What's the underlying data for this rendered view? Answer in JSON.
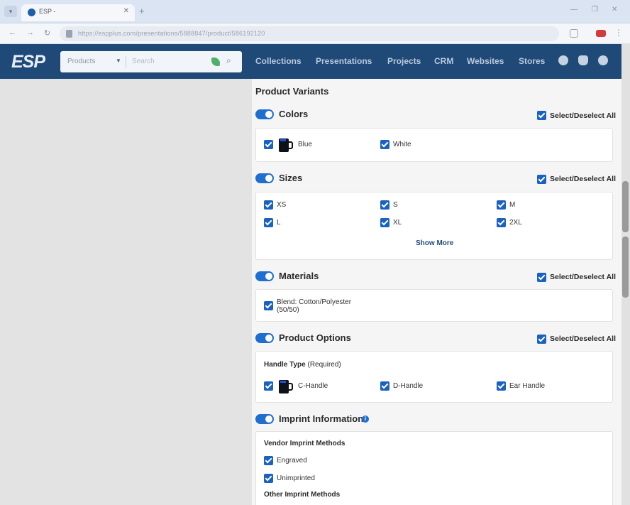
{
  "browser": {
    "tab_title": "ESP -",
    "url": "https://espplus.com/presentations/5888847/product/586192120"
  },
  "header": {
    "logo": "ESP",
    "search_category": "Products",
    "search_placeholder": "Search",
    "nav": [
      "Collections",
      "Presentations",
      "Projects",
      "CRM",
      "Websites",
      "Stores"
    ]
  },
  "panel": {
    "title": "Product Variants",
    "select_all_label": "Select/Deselect All",
    "colors": {
      "title": "Colors",
      "items": [
        "Blue",
        "White"
      ]
    },
    "sizes": {
      "title": "Sizes",
      "items": [
        "XS",
        "S",
        "M",
        "L",
        "XL",
        "2XL"
      ],
      "show_more": "Show More"
    },
    "materials": {
      "title": "Materials",
      "items": [
        "Blend: Cotton/Polyester",
        "(50/50)"
      ]
    },
    "product_options": {
      "title": "Product Options",
      "group_label": "Handle Type",
      "group_note": "(Required)",
      "items": [
        "C-Handle",
        "D-Handle",
        "Ear Handle"
      ]
    },
    "imprint": {
      "title": "Imprint Information",
      "vendor_label": "Vendor Imprint Methods",
      "vendor_items": [
        "Engraved",
        "Unimprinted"
      ],
      "other_label": "Other Imprint Methods"
    }
  },
  "colors": {
    "header_bg": "#1f4a78",
    "accent": "#1a62c0"
  }
}
